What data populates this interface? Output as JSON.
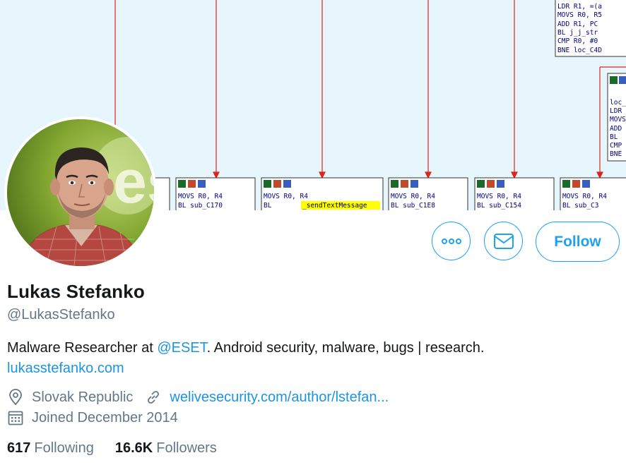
{
  "banner": {
    "code_blocks": [
      {
        "row1": "MOVS     R0, R4",
        "row2": "BL       sub_C170"
      },
      {
        "row1": "MOVS     R0, R4",
        "row2": "BL       ",
        "highlight": "_sendTextMessage"
      },
      {
        "row1": "MOVS     R0, R4",
        "row2": "BL       sub_C1E8"
      },
      {
        "row1": "MOVS     R0, R4",
        "row2": "BL       sub_C154"
      },
      {
        "row1": "MOVS     R0, R4",
        "row2": "BL       sub_C3"
      }
    ],
    "top_block": [
      "LDR     R1, =(a",
      "MOVS    R0, R5",
      "ADD     R1, PC",
      "BL      j_j_str",
      "CMP     R0, #0",
      "BNE     loc_C4D"
    ],
    "right_block": [
      "loc_",
      "LDR",
      "MOVS",
      "ADD",
      "BL",
      "CMP",
      "BNE"
    ]
  },
  "avatar": {
    "logo_text": "es",
    "icon": "profile-photo"
  },
  "actions": {
    "more_icon": "more-horizontal-icon",
    "message_icon": "envelope-icon",
    "follow_label": "Follow"
  },
  "profile": {
    "name": "Lukas Stefanko",
    "handle": "@LukasStefanko",
    "bio_prefix": "Malware Researcher at ",
    "bio_mention": "@ESET",
    "bio_suffix": ". Android security, malware, bugs | research.",
    "bio_link": "lukasstefanko.com",
    "location": "Slovak Republic",
    "website": "welivesecurity.com/author/lstefan...",
    "joined": "Joined December 2014"
  },
  "stats": {
    "following_count": "617",
    "following_label": "Following",
    "followers_count": "16.6K",
    "followers_label": "Followers"
  },
  "colors": {
    "accent": "#1da1f2",
    "link": "#1b95e0",
    "secondary_text": "#657786",
    "banner_bg": "#e6f6fc",
    "arrow": "#e0241c",
    "highlight": "#ffff00"
  }
}
